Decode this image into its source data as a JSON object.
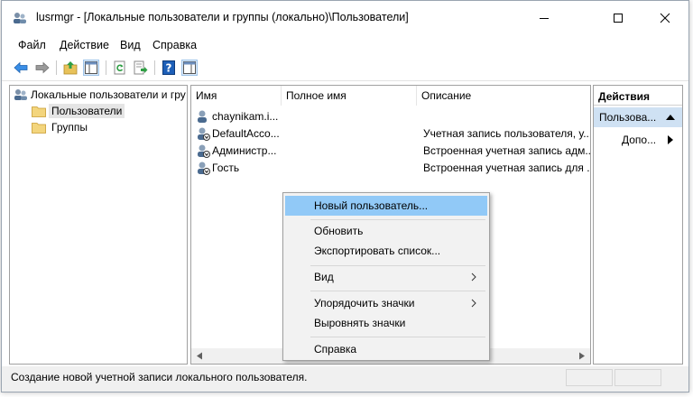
{
  "window": {
    "title": "lusrmgr - [Локальные пользователи и группы (локально)\\Пользователи]"
  },
  "menubar": {
    "items": [
      "Файл",
      "Действие",
      "Вид",
      "Справка"
    ]
  },
  "toolbar": {
    "icons": [
      "back-arrow-icon",
      "forward-arrow-icon",
      "up-folder-icon",
      "show-hide-tree-icon",
      "refresh-icon",
      "export-list-icon",
      "help-icon",
      "view-icon"
    ]
  },
  "tree": {
    "root": "Локальные пользователи и гру",
    "items": [
      "Пользователи",
      "Группы"
    ]
  },
  "list": {
    "columns": [
      "Имя",
      "Полное имя",
      "Описание"
    ],
    "rows": [
      {
        "name": "chaynikam.i...",
        "full_name": "",
        "description": ""
      },
      {
        "name": "DefaultAcco...",
        "full_name": "",
        "description": "Учетная запись пользователя, у..."
      },
      {
        "name": "Администр...",
        "full_name": "",
        "description": "Встроенная учетная запись адм..."
      },
      {
        "name": "Гость",
        "full_name": "",
        "description": "Встроенная учетная запись для ..."
      }
    ]
  },
  "actions": {
    "header": "Действия",
    "group": "Пользова...",
    "more": "Допо..."
  },
  "context_menu": {
    "items": [
      {
        "label": "Новый пользователь..."
      },
      {
        "label": "Обновить"
      },
      {
        "label": "Экспортировать список..."
      },
      {
        "label": "Вид"
      },
      {
        "label": "Упорядочить значки"
      },
      {
        "label": "Выровнять значки"
      },
      {
        "label": "Справка"
      }
    ]
  },
  "statusbar": {
    "text": "Создание новой учетной записи локального пользователя."
  },
  "colors": {
    "menu_highlight": "#91c9f7",
    "actions_group": "#cfe1f3",
    "toolbar_arrow": "#3a8ee6",
    "folder": "#e8c25a"
  }
}
